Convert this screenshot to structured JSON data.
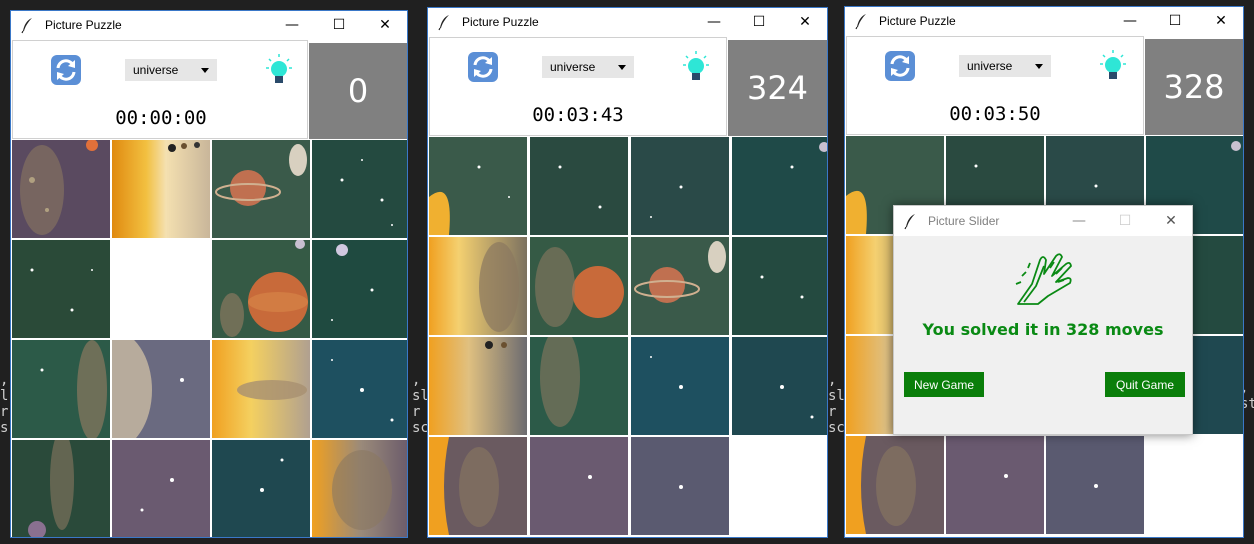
{
  "background_terminal": {
    "left_fragments": [
      ",",
      "l",
      "r",
      "s"
    ],
    "mid_fragments": [
      ",",
      "sl",
      "r",
      "sc"
    ],
    "right_fragments": [
      ",",
      "sl",
      "r",
      "sc"
    ],
    "far_right_fragments": [
      ",",
      "st"
    ]
  },
  "windows": [
    {
      "title": "Picture Puzzle",
      "controls": {
        "minimize": "—",
        "maximize": "☐",
        "close": "✕"
      },
      "theme": "universe",
      "timer": "00:00:00",
      "moves": "0"
    },
    {
      "title": "Picture Puzzle",
      "controls": {
        "minimize": "—",
        "maximize": "☐",
        "close": "✕"
      },
      "theme": "universe",
      "timer": "00:03:43",
      "moves": "324"
    },
    {
      "title": "Picture Puzzle",
      "controls": {
        "minimize": "—",
        "maximize": "☐",
        "close": "✕"
      },
      "theme": "universe",
      "timer": "00:03:50",
      "moves": "328"
    }
  ],
  "dialog": {
    "title": "Picture Slider",
    "controls": {
      "minimize": "—",
      "maximize": "☐",
      "close": "✕"
    },
    "message": "You solved it in 328 moves",
    "new_game": "New Game",
    "quit_game": "Quit Game"
  },
  "icons": {
    "app": "feather-icon",
    "refresh": "refresh-icon",
    "hint": "lightbulb-icon",
    "applause": "clapping-hands-icon"
  },
  "colors": {
    "counter_bg": "#808080",
    "dialog_button": "#0a7e0a",
    "message": "#0a8a14",
    "bulb": "#2ee6d6"
  }
}
